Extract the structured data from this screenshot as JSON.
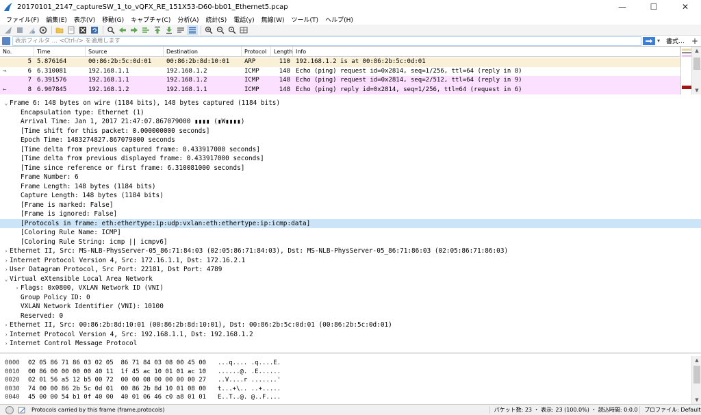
{
  "window": {
    "title": "20170101_2147_captureSW_1_to_vQFX_RE_151X53-D60-bb01_Ethernet5.pcap",
    "minimize": "—",
    "maximize": "☐",
    "close": "✕"
  },
  "menu": [
    "ファイル(F)",
    "編集(E)",
    "表示(V)",
    "移動(G)",
    "キャプチャ(C)",
    "分析(A)",
    "統計(S)",
    "電話(y)",
    "無線(W)",
    "ツール(T)",
    "ヘルプ(H)"
  ],
  "filter": {
    "placeholder": "表示フィルタ … <Ctrl-/> を適用します",
    "dropdown": "▾",
    "expression_label": "書式…",
    "add_label": "+"
  },
  "packet_list": {
    "columns": [
      "No.",
      "Time",
      "Source",
      "Destination",
      "Protocol",
      "Length",
      "Info"
    ],
    "rows": [
      {
        "no": "5",
        "time": "5.876164",
        "src": "00:86:2b:5c:0d:01",
        "dst": "00:86:2b:8d:10:01",
        "proto": "ARP",
        "len": "110",
        "info": "192.168.1.2 is at 00:86:2b:5c:0d:01",
        "bg": "#faf0d7",
        "arrow": ""
      },
      {
        "no": "6",
        "time": "6.310081",
        "src": "192.168.1.1",
        "dst": "192.168.1.2",
        "proto": "ICMP",
        "len": "148",
        "info": "Echo (ping) request  id=0x2814, seq=1/256, ttl=64 (reply in 8)",
        "bg": "#ffffff",
        "arrow": "→"
      },
      {
        "no": "7",
        "time": "6.391576",
        "src": "192.168.1.1",
        "dst": "192.168.1.2",
        "proto": "ICMP",
        "len": "148",
        "info": "Echo (ping) request  id=0x2814, seq=2/512, ttl=64 (reply in 9)",
        "bg": "#fce0ff",
        "arrow": ""
      },
      {
        "no": "8",
        "time": "6.907845",
        "src": "192.168.1.2",
        "dst": "192.168.1.1",
        "proto": "ICMP",
        "len": "148",
        "info": "Echo (ping) reply    id=0x2814, seq=1/256, ttl=64 (request in 6)",
        "bg": "#fce0ff",
        "arrow": "←"
      }
    ]
  },
  "details": [
    {
      "text": "Frame 6: 148 bytes on wire (1184 bits), 148 bytes captured (1184 bits)",
      "indent": 0,
      "twisty": "⌄",
      "selected": false
    },
    {
      "text": "Encapsulation type: Ethernet (1)",
      "indent": 1,
      "twisty": "",
      "selected": false
    },
    {
      "text": "Arrival Time: Jan  1, 2017 21:47:07.867079000 ▮▮▮▮ (▮W▮▮▮▮)",
      "indent": 1,
      "twisty": "",
      "selected": false
    },
    {
      "text": "[Time shift for this packet: 0.000000000 seconds]",
      "indent": 1,
      "twisty": "",
      "selected": false
    },
    {
      "text": "Epoch Time: 1483274827.867079000 seconds",
      "indent": 1,
      "twisty": "",
      "selected": false
    },
    {
      "text": "[Time delta from previous captured frame: 0.433917000 seconds]",
      "indent": 1,
      "twisty": "",
      "selected": false
    },
    {
      "text": "[Time delta from previous displayed frame: 0.433917000 seconds]",
      "indent": 1,
      "twisty": "",
      "selected": false
    },
    {
      "text": "[Time since reference or first frame: 6.310081000 seconds]",
      "indent": 1,
      "twisty": "",
      "selected": false
    },
    {
      "text": "Frame Number: 6",
      "indent": 1,
      "twisty": "",
      "selected": false
    },
    {
      "text": "Frame Length: 148 bytes (1184 bits)",
      "indent": 1,
      "twisty": "",
      "selected": false
    },
    {
      "text": "Capture Length: 148 bytes (1184 bits)",
      "indent": 1,
      "twisty": "",
      "selected": false
    },
    {
      "text": "[Frame is marked: False]",
      "indent": 1,
      "twisty": "",
      "selected": false
    },
    {
      "text": "[Frame is ignored: False]",
      "indent": 1,
      "twisty": "",
      "selected": false
    },
    {
      "text": "[Protocols in frame: eth:ethertype:ip:udp:vxlan:eth:ethertype:ip:icmp:data]",
      "indent": 1,
      "twisty": "",
      "selected": true
    },
    {
      "text": "[Coloring Rule Name: ICMP]",
      "indent": 1,
      "twisty": "",
      "selected": false
    },
    {
      "text": "[Coloring Rule String: icmp || icmpv6]",
      "indent": 1,
      "twisty": "",
      "selected": false
    },
    {
      "text": "Ethernet II, Src: MS-NLB-PhysServer-05_86:71:84:03 (02:05:86:71:84:03), Dst: MS-NLB-PhysServer-05_86:71:86:03 (02:05:86:71:86:03)",
      "indent": 0,
      "twisty": "›",
      "selected": false
    },
    {
      "text": "Internet Protocol Version 4, Src: 172.16.1.1, Dst: 172.16.2.1",
      "indent": 0,
      "twisty": "›",
      "selected": false
    },
    {
      "text": "User Datagram Protocol, Src Port: 22181, Dst Port: 4789",
      "indent": 0,
      "twisty": "›",
      "selected": false
    },
    {
      "text": "Virtual eXtensible Local Area Network",
      "indent": 0,
      "twisty": "⌄",
      "selected": false
    },
    {
      "text": "Flags: 0x0800, VXLAN Network ID (VNI)",
      "indent": 1,
      "twisty": "›",
      "selected": false
    },
    {
      "text": "Group Policy ID: 0",
      "indent": 1,
      "twisty": "",
      "selected": false
    },
    {
      "text": "VXLAN Network Identifier (VNI): 10100",
      "indent": 1,
      "twisty": "",
      "selected": false
    },
    {
      "text": "Reserved: 0",
      "indent": 1,
      "twisty": "",
      "selected": false
    },
    {
      "text": "Ethernet II, Src: 00:86:2b:8d:10:01 (00:86:2b:8d:10:01), Dst: 00:86:2b:5c:0d:01 (00:86:2b:5c:0d:01)",
      "indent": 0,
      "twisty": "›",
      "selected": false
    },
    {
      "text": "Internet Protocol Version 4, Src: 192.168.1.1, Dst: 192.168.1.2",
      "indent": 0,
      "twisty": "›",
      "selected": false
    },
    {
      "text": "Internet Control Message Protocol",
      "indent": 0,
      "twisty": "›",
      "selected": false
    }
  ],
  "bytes": [
    {
      "offset": "0000",
      "hex": "02 05 86 71 86 03 02 05  86 71 84 03 08 00 45 00",
      "ascii": "...q.... .q....E."
    },
    {
      "offset": "0010",
      "hex": "00 86 00 00 00 00 40 11  1f 45 ac 10 01 01 ac 10",
      "ascii": "......@. .E......"
    },
    {
      "offset": "0020",
      "hex": "02 01 56 a5 12 b5 00 72  00 00 08 00 00 00 00 27",
      "ascii": "..V....r .......'"
    },
    {
      "offset": "0030",
      "hex": "74 00 00 86 2b 5c 0d 01  00 86 2b 8d 10 01 08 00",
      "ascii": "t...+\\.. ..+....."
    },
    {
      "offset": "0040",
      "hex": "45 00 00 54 b1 0f 40 00  40 01 06 46 c0 a8 01 01",
      "ascii": "E..T..@. @..F...."
    }
  ],
  "status": {
    "text": "Protocols carried by this frame (frame.protocols)",
    "counts": "パケット数: 23 ・ 表示: 23 (100.0%) ・ 読込時間: 0:0.0",
    "profile": "プロファイル: Default"
  },
  "colors": {
    "selected_detail": "#cce4f7",
    "arp_row": "#faf0d7",
    "icmp_row": "#fce0ff",
    "accent": "#3b7fd6"
  }
}
